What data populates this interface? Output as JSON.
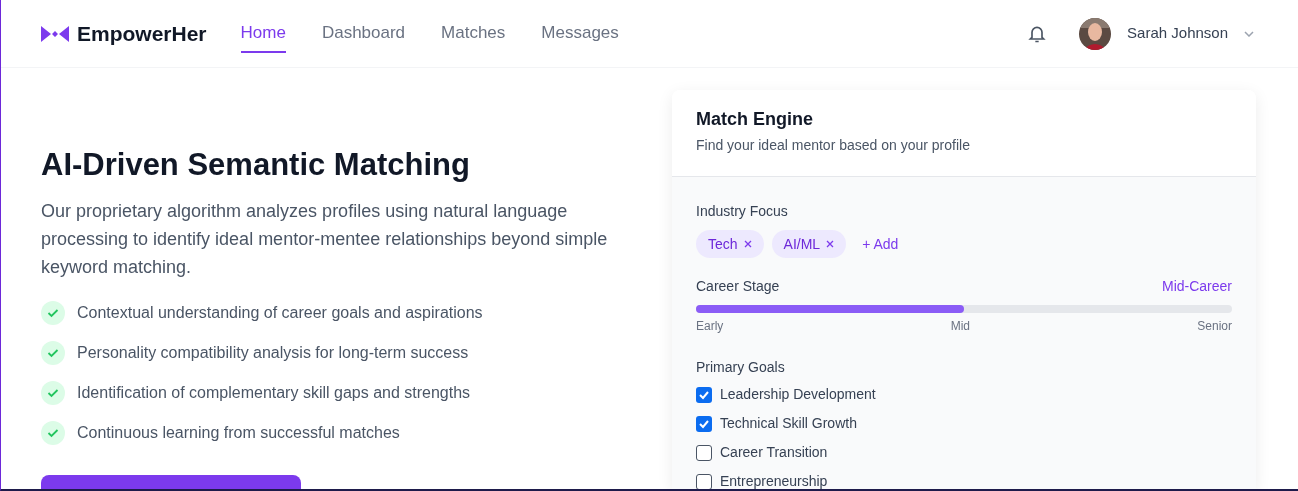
{
  "nav": {
    "brand": "EmpowerHer",
    "links": [
      {
        "label": "Home",
        "selected": true
      },
      {
        "label": "Dashboard",
        "selected": false
      },
      {
        "label": "Matches",
        "selected": false
      },
      {
        "label": "Messages",
        "selected": false
      }
    ],
    "user": "Sarah Johnson"
  },
  "hero": {
    "title": "AI-Driven Semantic Matching",
    "description": "Our proprietary algorithm analyzes profiles using natural language processing to identify ideal mentor-mentee relationships beyond simple keyword matching.",
    "features": [
      "Contextual understanding of career goals and aspirations",
      "Personality compatibility analysis for long-term success",
      "Identification of complementary skill gaps and strengths",
      "Continuous learning from successful matches"
    ]
  },
  "match_engine": {
    "title": "Match Engine",
    "subtitle": "Find your ideal mentor based on your profile",
    "industry": {
      "label": "Industry Focus",
      "tags": [
        "Tech",
        "AI/ML"
      ],
      "add": "+ Add"
    },
    "career_stage": {
      "label": "Career Stage",
      "value": "Mid-Career",
      "level": 0.5,
      "ticks": [
        "Early",
        "Mid",
        "Senior"
      ]
    },
    "goals": {
      "label": "Primary Goals",
      "items": [
        {
          "label": "Leadership Development",
          "checked": true
        },
        {
          "label": "Technical Skill Growth",
          "checked": true
        },
        {
          "label": "Career Transition",
          "checked": false
        },
        {
          "label": "Entrepreneurship",
          "checked": false
        }
      ]
    }
  }
}
